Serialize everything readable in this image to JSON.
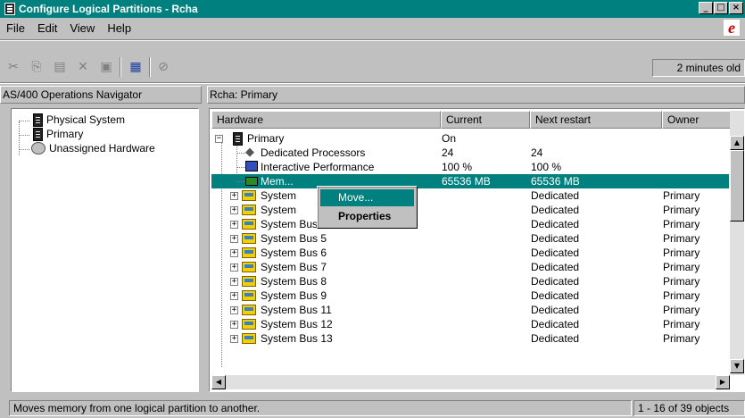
{
  "window": {
    "title": "Configure Logical Partitions - Rcha",
    "buttons": [
      "_",
      "□",
      "×"
    ]
  },
  "menu": {
    "items": [
      "File",
      "Edit",
      "View",
      "Help"
    ],
    "logo": "e"
  },
  "toolbar": {
    "icons": [
      "cut-icon",
      "copy-icon",
      "paste-icon",
      "delete-icon",
      "properties-icon",
      "view-icon",
      "stop-icon"
    ],
    "refresh_status": "2 minutes old"
  },
  "left_panel": {
    "title": "AS/400 Operations Navigator",
    "items": [
      "Physical System",
      "Primary",
      "Unassigned Hardware"
    ]
  },
  "right_panel": {
    "title": "Rcha:  Primary",
    "columns": [
      "Hardware",
      "Current",
      "Next restart",
      "Owner"
    ],
    "rows": [
      {
        "name": "Primary",
        "current": "On",
        "next": "",
        "owner": ""
      },
      {
        "name": "Dedicated Processors",
        "current": "24",
        "next": "24",
        "owner": ""
      },
      {
        "name": "Interactive Performance",
        "current": "100 %",
        "next": "100 %",
        "owner": ""
      },
      {
        "name": "Mem...",
        "current": "65536 MB",
        "next": "65536 MB",
        "owner": ""
      },
      {
        "name": "System",
        "current": "",
        "next": "Dedicated",
        "owner": "Primary"
      },
      {
        "name": "System",
        "current": "",
        "next": "Dedicated",
        "owner": "Primary"
      },
      {
        "name": "System Bus 4",
        "current": "",
        "next": "Dedicated",
        "owner": "Primary"
      },
      {
        "name": "System Bus 5",
        "current": "",
        "next": "Dedicated",
        "owner": "Primary"
      },
      {
        "name": "System Bus 6",
        "current": "",
        "next": "Dedicated",
        "owner": "Primary"
      },
      {
        "name": "System Bus 7",
        "current": "",
        "next": "Dedicated",
        "owner": "Primary"
      },
      {
        "name": "System Bus 8",
        "current": "",
        "next": "Dedicated",
        "owner": "Primary"
      },
      {
        "name": "System Bus 9",
        "current": "",
        "next": "Dedicated",
        "owner": "Primary"
      },
      {
        "name": "System Bus 11",
        "current": "",
        "next": "Dedicated",
        "owner": "Primary"
      },
      {
        "name": "System Bus 12",
        "current": "",
        "next": "Dedicated",
        "owner": "Primary"
      },
      {
        "name": "System Bus 13",
        "current": "",
        "next": "Dedicated",
        "owner": "Primary"
      }
    ]
  },
  "context_menu": {
    "items": [
      "Move...",
      "Properties"
    ]
  },
  "status_bar": {
    "message": "Moves memory from one logical partition to another.",
    "count": "1 - 16 of 39 objects"
  }
}
